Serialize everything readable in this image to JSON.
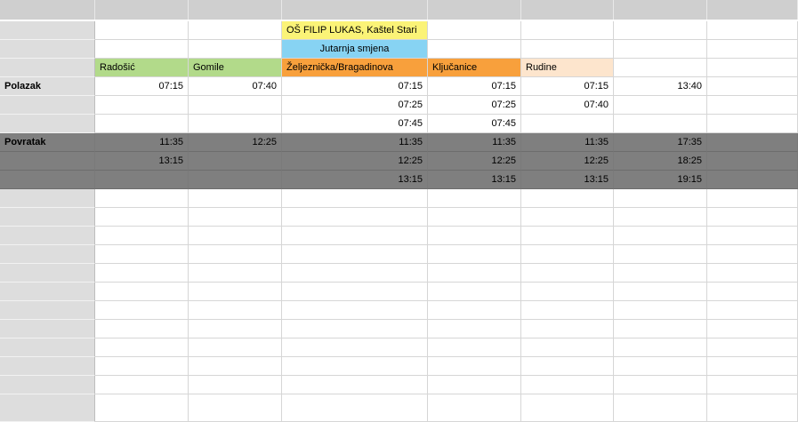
{
  "colors": {
    "yellow": "#fbf377",
    "light_blue": "#87d3f3",
    "green": "#b2da8a",
    "orange": "#f8a03c",
    "peach": "#fde5cd",
    "dark_gray": "#7f7f7f",
    "header_gray": "#cfcfcf",
    "rowhdr_gray": "#dddddd"
  },
  "header": {
    "school": "OŠ FILIP LUKAS, Kaštel Stari",
    "shift": "Jutarnja smjena"
  },
  "stops": [
    "Radošić",
    "Gomile",
    "Željeznička/Bragadinova",
    "Ključanice",
    "Rudine"
  ],
  "stop_colors": [
    "green",
    "green",
    "orange",
    "orange",
    "peach"
  ],
  "polazak_label": "Polazak",
  "povratak_label": "Povratak",
  "polazak": [
    [
      "07:15",
      "07:40",
      "07:15",
      "07:15",
      "07:15",
      "13:40"
    ],
    [
      "",
      "",
      "07:25",
      "07:25",
      "07:40",
      ""
    ],
    [
      "",
      "",
      "07:45",
      "07:45",
      "",
      ""
    ]
  ],
  "povratak": [
    [
      "11:35",
      "12:25",
      "11:35",
      "11:35",
      "11:35",
      "17:35"
    ],
    [
      "13:15",
      "",
      "12:25",
      "12:25",
      "12:25",
      "18:25"
    ],
    [
      "",
      "",
      "13:15",
      "13:15",
      "13:15",
      "19:15"
    ]
  ]
}
